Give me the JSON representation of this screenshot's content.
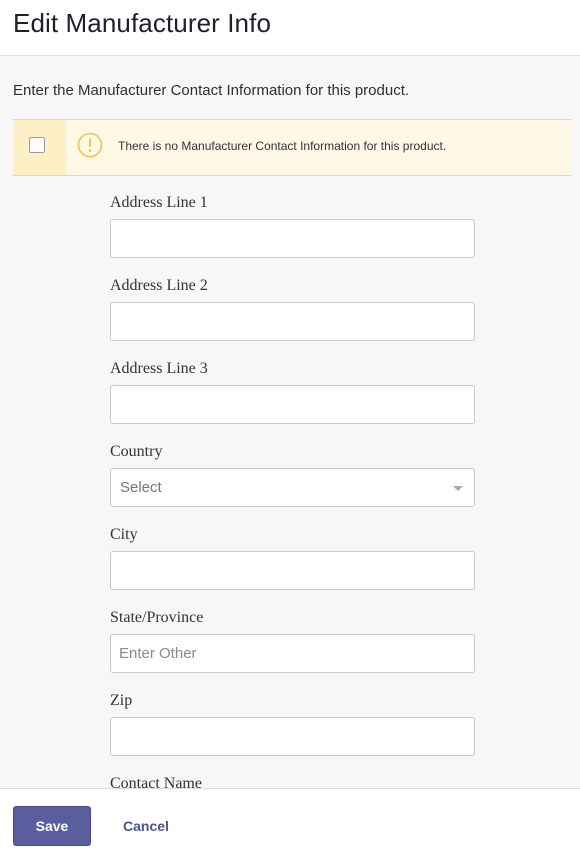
{
  "header": {
    "title": "Edit Manufacturer Info"
  },
  "intro": "Enter the Manufacturer Contact Information for this product.",
  "alert": {
    "icon": "warning-icon",
    "message": "There is no Manufacturer Contact Information for this product.",
    "checked": false,
    "accent_color": "#f5c542"
  },
  "form": {
    "fields": [
      {
        "label": "Address Line 1",
        "type": "text",
        "value": "",
        "placeholder": ""
      },
      {
        "label": "Address Line 2",
        "type": "text",
        "value": "",
        "placeholder": ""
      },
      {
        "label": "Address Line 3",
        "type": "text",
        "value": "",
        "placeholder": ""
      },
      {
        "label": "Country",
        "type": "select",
        "value": "Select",
        "placeholder": ""
      },
      {
        "label": "City",
        "type": "text",
        "value": "",
        "placeholder": ""
      },
      {
        "label": "State/Province",
        "type": "text",
        "value": "",
        "placeholder": "Enter Other"
      },
      {
        "label": "Zip",
        "type": "text",
        "value": "",
        "placeholder": ""
      },
      {
        "label": "Contact Name",
        "type": "text",
        "value": "",
        "placeholder": ""
      }
    ]
  },
  "footer": {
    "save_label": "Save",
    "cancel_label": "Cancel",
    "primary_color": "#5b5e9e"
  }
}
